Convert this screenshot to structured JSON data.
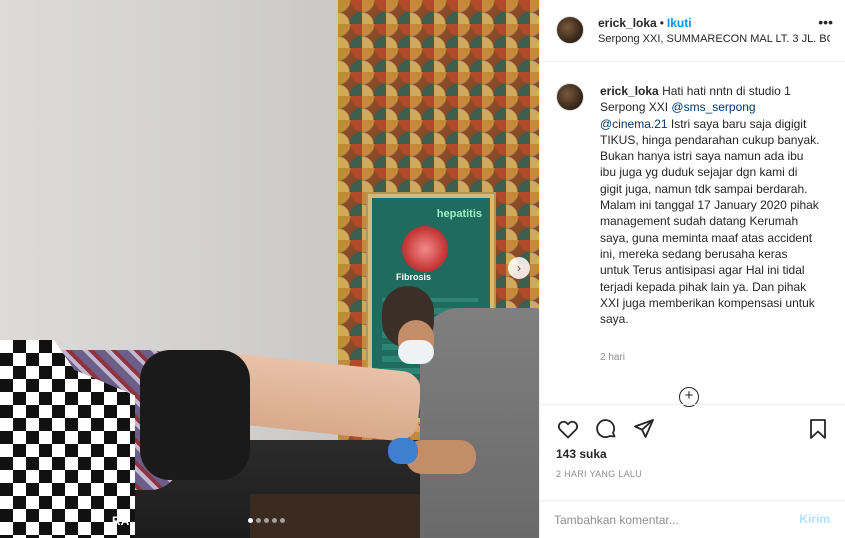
{
  "post": {
    "username": "erick_loka",
    "separator": "•",
    "follow_label": "Ikuti",
    "location": "Serpong XXI, SUMMARECON MAL LT. 3 JL. BO…",
    "more_label": "•••"
  },
  "caption": {
    "username": "erick_loka",
    "text_1": "Hati hati nntn di studio 1 Serpong XXI ",
    "mention_1": "@sms_serpong",
    "mention_2": "@cinema.21",
    "text_2": " Istri saya baru saja digigit TIKUS, hinga pendarahan cukup banyak. Bukan hanya istri saya namun ada ibu ibu juga yg duduk sejajar dgn kami di gigit juga, namun tdk sampai berdarah. Malam ini tanggal 17 January 2020 pihak management sudah datang Kerumah saya, guna meminta maaf atas accident ini, mereka sedang berusaha keras untuk Terus antisipasi agar Hal ini tidal terjadi kepada pihak lain ya. Dan pihak XXI juga memberikan kompensasi untuk saya.",
    "time": "2 hari"
  },
  "photo": {
    "poster_title": "hepatitis",
    "poster_label": "Fibrosis",
    "watermark": "RA",
    "carousel_count": 5,
    "carousel_active": 0
  },
  "actions": {
    "likes": "143 suka",
    "date": "2 HARI YANG LALU",
    "comment_placeholder": "Tambahkan komentar...",
    "post_label": "Kirim"
  },
  "icons": {
    "heart": "heart-icon",
    "comment": "comment-icon",
    "share": "share-icon",
    "bookmark": "bookmark-icon",
    "add": "plus-circle-icon",
    "next": "chevron-right-icon"
  },
  "colors": {
    "link_blue": "#0095f6",
    "mention": "#00376b",
    "muted": "#8e8e8e",
    "post_disabled": "#b2dffc"
  }
}
